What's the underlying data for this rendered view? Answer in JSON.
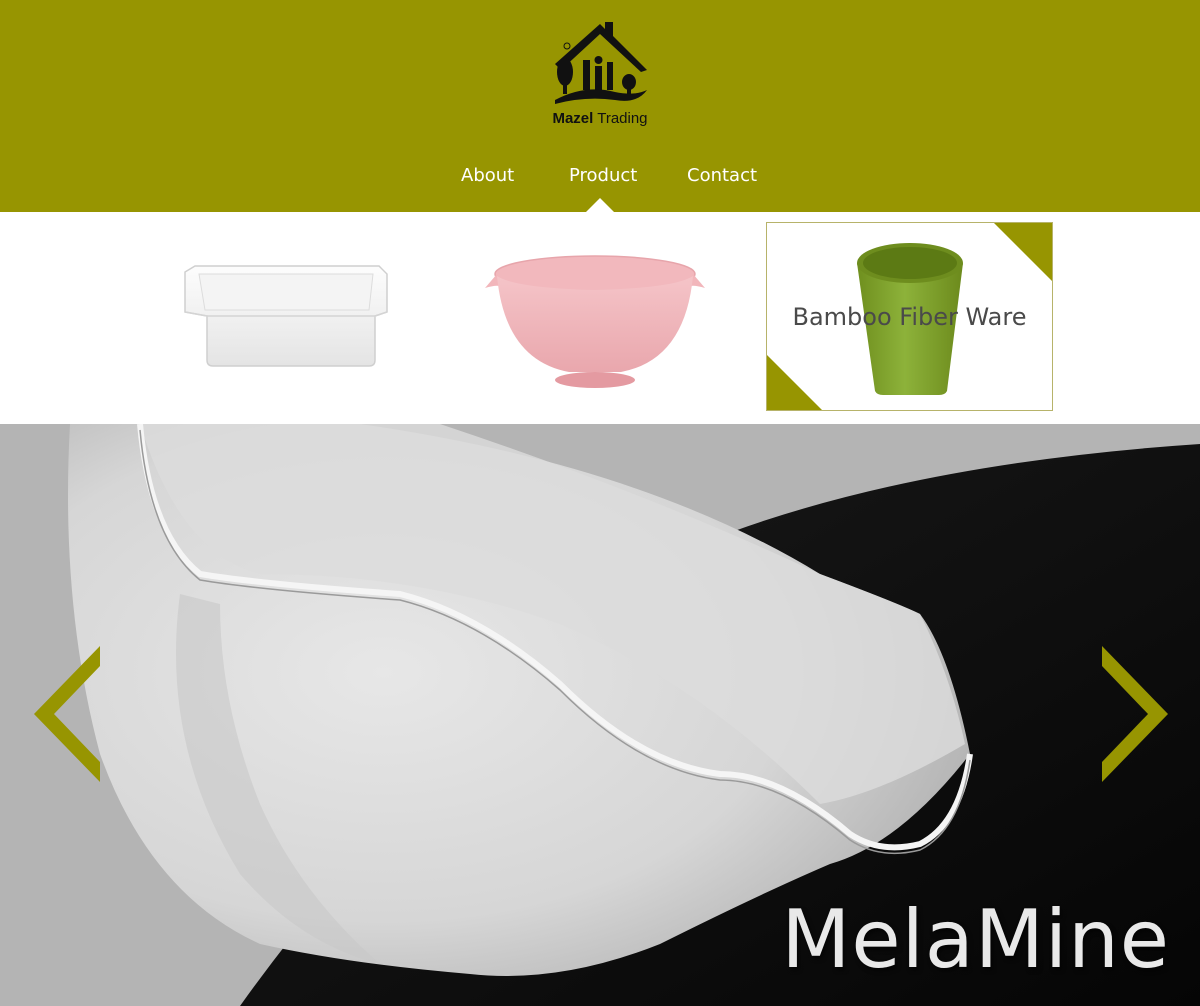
{
  "brand": {
    "name_bold": "Mazel",
    "name_regular": "Trading"
  },
  "nav": {
    "items": [
      {
        "label": "About"
      },
      {
        "label": "Product"
      },
      {
        "label": "Contact"
      }
    ]
  },
  "products": {
    "cards": [
      {
        "label": ""
      },
      {
        "label": ""
      },
      {
        "label": "Bamboo Fiber Ware"
      }
    ]
  },
  "hero": {
    "title": "MelaMine"
  },
  "colors": {
    "accent": "#979501",
    "white": "#ffffff",
    "dark": "#111111"
  }
}
